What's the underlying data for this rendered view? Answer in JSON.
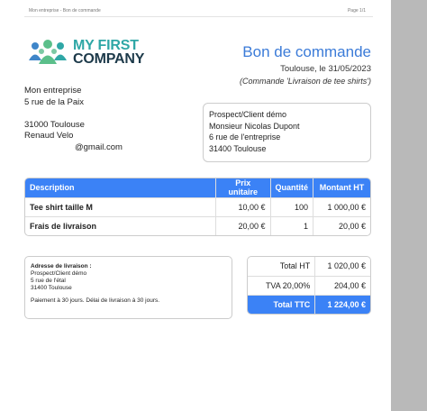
{
  "header": {
    "left": "Mon entreprise - Bon de commande",
    "right": "Page 1/1"
  },
  "logo": {
    "line1": "MY FIRST",
    "line2": "COMPANY",
    "colors": {
      "teal": "#2fa7a6",
      "navy": "#1d3a4a",
      "green": "#5bbf8a",
      "blue": "#3f86c9"
    }
  },
  "doc": {
    "title": "Bon de commande",
    "date": "Toulouse, le 31/05/2023",
    "subject": "(Commande 'Livraison de tee shirts')"
  },
  "sender": {
    "name": "Mon entreprise",
    "street": "5 rue de la Paix",
    "blank": "",
    "city": "31000 Toulouse",
    "contact": "Renaud Velo",
    "email": "@gmail.com"
  },
  "client": {
    "line1": "Prospect/Client démo",
    "line2": "Monsieur Nicolas Dupont",
    "line3": "6 rue de l'entreprise",
    "line4": "31400 Toulouse"
  },
  "items": {
    "headers": [
      "Description",
      "Prix unitaire",
      "Quantité",
      "Montant HT"
    ],
    "rows": [
      {
        "desc": "Tee shirt taille M",
        "price": "10,00 €",
        "qty": "100",
        "amount": "1 000,00 €"
      },
      {
        "desc": "Frais de livraison",
        "price": "20,00 €",
        "qty": "1",
        "amount": "20,00 €"
      }
    ]
  },
  "delivery": {
    "label": "Adresse de livraison :",
    "line1": "Prospect/Client démo",
    "line2": "5 rue de l'étal",
    "line3": "31400 Toulouse",
    "payment": "Paiement à 30 jours. Délai de livraison à 30 jours."
  },
  "totals": {
    "ht_label": "Total HT",
    "ht_value": "1 020,00 €",
    "tva_label": "TVA 20,00%",
    "tva_value": "204,00 €",
    "ttc_label": "Total TTC",
    "ttc_value": "1 224,00 €"
  },
  "colors": {
    "accent": "#3b82f6",
    "title": "#3b7bd8"
  }
}
